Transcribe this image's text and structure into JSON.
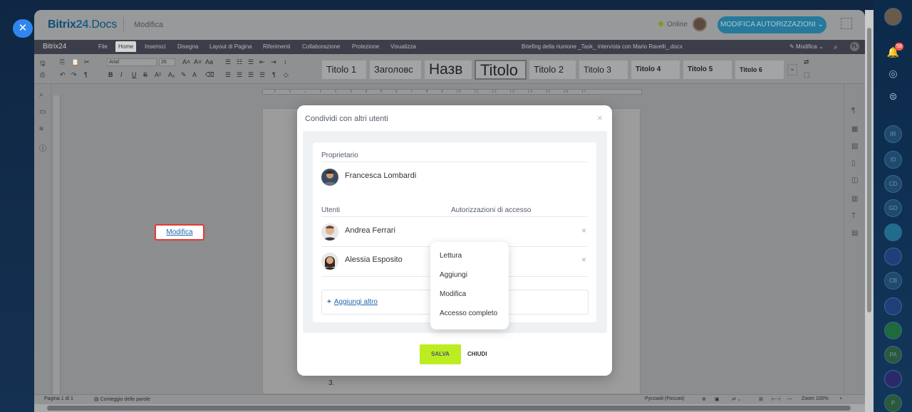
{
  "editor": {
    "brand_prefix": "Bitrix",
    "brand_num": "24",
    "brand_suffix": ".Docs",
    "mode": "Modifica",
    "online": "Online",
    "perm_button": "MODIFICA AUTORIZZAZIONI",
    "menu_logo": "Bitrix24",
    "menu": [
      "File",
      "Home",
      "Inserisci",
      "Disegna",
      "Layout di Pagina",
      "Riferimenti",
      "Collaborazione",
      "Protezione",
      "Visualizza"
    ],
    "active_menu": "Home",
    "filename": "Briefing della riunione _Task_ intervista con Mario Ravelli_.docx",
    "right_mode": "Modifica",
    "user_initials": "FL",
    "font_name": "Arial",
    "font_size": "26",
    "styles": [
      "Titolo 1",
      "Заголовс",
      "Назв",
      "Titolo",
      "Titolo 2",
      "Titolo 3",
      "Titolo 4",
      "Titolo 5",
      "Titolo 6"
    ],
    "page_list_number": "3.",
    "status_left": "Pagina 1 di 1",
    "status_words": "Conteggio delle parole",
    "status_lang": "Русский (Россия)",
    "status_zoom": "Zoom 100%"
  },
  "dialog": {
    "title": "Condividi con altri utenti",
    "owner_label": "Proprietario",
    "owner_name": "Francesca Lombardi",
    "users_label": "Utenti",
    "access_label": "Autorizzazioni di accesso",
    "users": [
      {
        "name": "Andrea Ferrari",
        "permission": "Modifica"
      },
      {
        "name": "Alessia Esposito",
        "permission": ""
      }
    ],
    "add_more": "Aggiungi altro",
    "save": "SALVA",
    "close": "CHIUDI"
  },
  "permission_menu": {
    "options": [
      "Lettura",
      "Aggiungi",
      "Modifica",
      "Accesso completo"
    ]
  },
  "sidebar": {
    "notification_count": "58",
    "avatars": [
      "IR",
      "ID",
      "CD",
      "GD",
      "CB",
      "PA",
      "P"
    ]
  },
  "colors": {
    "accent": "#2f86ef",
    "save_button": "#bbed21",
    "link": "#2067b0",
    "highlight_border": "#e53934"
  }
}
